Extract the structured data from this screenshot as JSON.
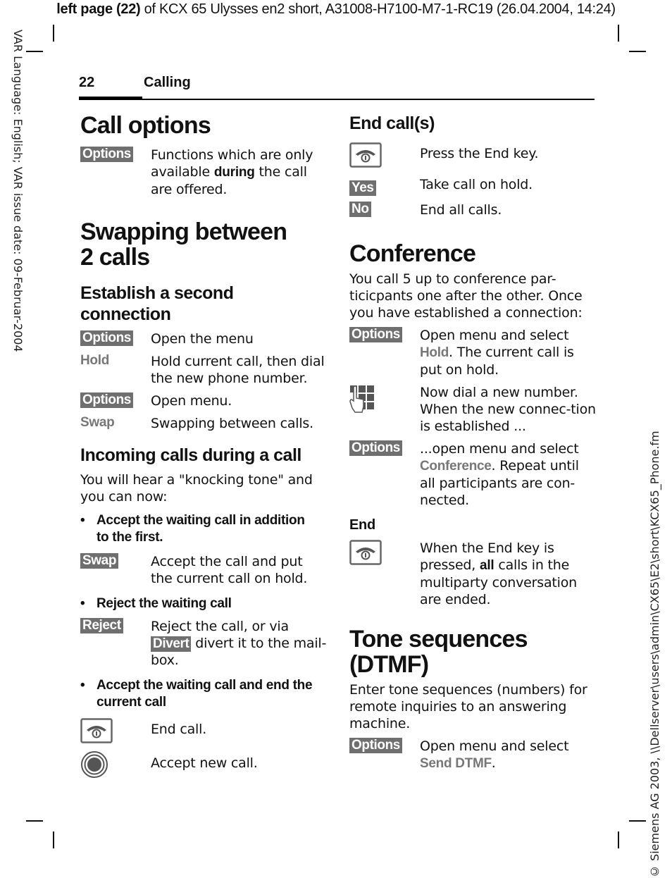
{
  "header_line": {
    "bold": "left page (22)",
    "rest": " of KCX 65 Ulysses en2 short, A31008-H7100-M7-1-RC19 (26.04.2004, 14:24)"
  },
  "margin_left_text": "VAR Language: English; VAR issue date: 09-Februar-2004",
  "margin_right_text": "© Siemens AG 2003, \\\\Dellserver\\users\\admin\\CX65\\E2\\short\\KCX65_Phone.fm",
  "running_head": {
    "page_number": "22",
    "title": "Calling"
  },
  "left_column": {
    "call_options": {
      "title": "Call options",
      "rows": [
        {
          "key": "Options",
          "desc_pre": "Functions which are only available ",
          "desc_bold": "during",
          "desc_post": " the call are offered."
        }
      ]
    },
    "swapping": {
      "title_line1": "Swapping between",
      "title_line2": "2 calls",
      "second_connection": {
        "title": "Establish a second connection",
        "rows": [
          {
            "key": "Options",
            "key_type": "softkey",
            "desc": "Open the menu"
          },
          {
            "key": "Hold",
            "key_type": "menuitem",
            "desc": "Hold current call, then dial the new phone number."
          },
          {
            "key": "Options",
            "key_type": "softkey",
            "desc": "Open menu."
          },
          {
            "key": "Swap",
            "key_type": "menuitem",
            "desc": "Swapping between calls."
          }
        ]
      },
      "incoming": {
        "title": "Incoming calls during a call",
        "intro": "You will hear a \"knocking tone\" and you can now:",
        "bullet1": "Accept the waiting call in addition to the first.",
        "row_swap": {
          "key": "Swap",
          "desc": "Accept the call and put the current call on hold."
        },
        "bullet2": "Reject the waiting call",
        "row_reject": {
          "key": "Reject",
          "desc_pre": "Reject the call, or via ",
          "inline_key": "Divert",
          "desc_post": " divert it to the mail-box."
        },
        "bullet3": "Accept the waiting call and end the current call",
        "row_end": {
          "icon": "end-key-icon",
          "desc": "End call."
        },
        "row_accept": {
          "icon": "control-key-icon",
          "desc": "Accept new call."
        }
      }
    }
  },
  "right_column": {
    "end_calls": {
      "title": "End call(s)",
      "rows": [
        {
          "icon": "end-key-icon",
          "desc": "Press the End key."
        },
        {
          "key": "Yes",
          "desc": "Take call on hold."
        },
        {
          "key": "No",
          "desc": "End all calls."
        }
      ]
    },
    "conference": {
      "title": "Conference",
      "intro": "You call 5 up to conference par-ticicpants one after the other. Once you have established a connection:",
      "row1": {
        "key": "Options",
        "desc_pre": "Open menu and select ",
        "menu": "Hold",
        "desc_post": ". The current call is put on hold."
      },
      "row2": {
        "icon": "keypad-icon",
        "desc": "Now dial a new number. When the new connec-tion is established ..."
      },
      "row3": {
        "key": "Options",
        "desc_pre": "...open menu and select ",
        "menu": "Conference",
        "desc_post": ". Repeat until all participants are con-nected."
      },
      "end_heading": "End",
      "row4": {
        "icon": "end-key-icon",
        "desc_pre": "When the End key is pressed, ",
        "desc_bold": "all",
        "desc_post": " calls in the multiparty conversation are ended."
      }
    },
    "dtmf": {
      "title": "Tone sequences (DTMF)",
      "intro": "Enter tone sequences (numbers) for remote inquiries to an answering machine.",
      "row1": {
        "key": "Options",
        "desc_pre": "Open menu and select ",
        "menu": "Send DTMF",
        "desc_post": "."
      }
    }
  },
  "colors": {
    "softkey_bg": "#6f6f6f",
    "softkey_text": "#ffffff",
    "menu_item": "#777777",
    "text": "#111111"
  }
}
